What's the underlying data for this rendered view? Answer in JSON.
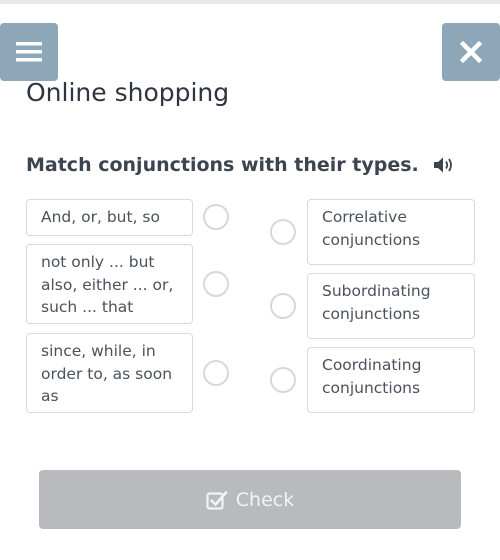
{
  "header": {
    "menu_icon": "hamburger-menu-icon",
    "close_icon": "close-x-icon",
    "title": "Online shopping"
  },
  "task": {
    "title": "Match conjunctions with their types.",
    "audio_icon": "speaker-icon"
  },
  "left_items": [
    {
      "text": "And, or, but, so"
    },
    {
      "text": "not only ... but also, either ... or, such ... that"
    },
    {
      "text": "since, while, in order to, as soon as"
    }
  ],
  "right_items": [
    {
      "text": "Correlative conjunctions"
    },
    {
      "text": "Subordinating conjunctions"
    },
    {
      "text": "Coordinating conjunctions"
    }
  ],
  "footer": {
    "check_label": "Check",
    "check_icon": "checkbox-icon"
  },
  "colors": {
    "header_buttons": "#8da6b8",
    "check_button_disabled": "#b8babd",
    "card_border": "#d8dbde"
  }
}
